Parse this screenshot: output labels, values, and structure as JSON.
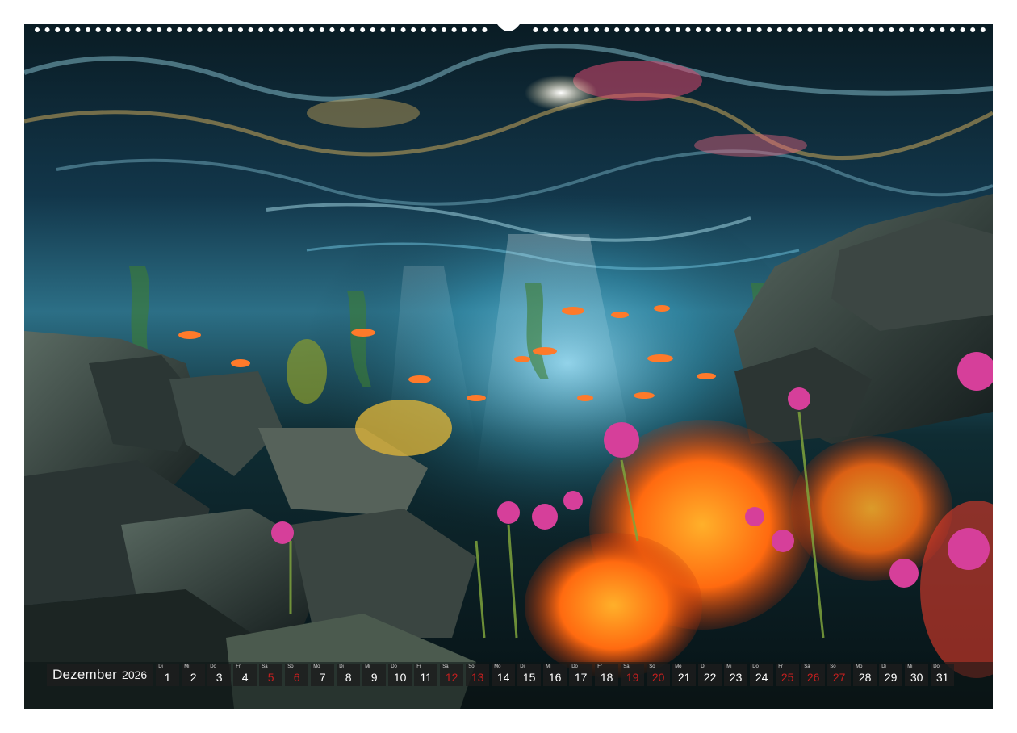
{
  "calendar": {
    "month": "Dezember",
    "year": "2026",
    "days": [
      {
        "wd": "Di",
        "n": "1",
        "red": false
      },
      {
        "wd": "Mi",
        "n": "2",
        "red": false
      },
      {
        "wd": "Do",
        "n": "3",
        "red": false
      },
      {
        "wd": "Fr",
        "n": "4",
        "red": false
      },
      {
        "wd": "Sa",
        "n": "5",
        "red": true
      },
      {
        "wd": "So",
        "n": "6",
        "red": true
      },
      {
        "wd": "Mo",
        "n": "7",
        "red": false
      },
      {
        "wd": "Di",
        "n": "8",
        "red": false
      },
      {
        "wd": "Mi",
        "n": "9",
        "red": false
      },
      {
        "wd": "Do",
        "n": "10",
        "red": false
      },
      {
        "wd": "Fr",
        "n": "11",
        "red": false
      },
      {
        "wd": "Sa",
        "n": "12",
        "red": true
      },
      {
        "wd": "So",
        "n": "13",
        "red": true
      },
      {
        "wd": "Mo",
        "n": "14",
        "red": false
      },
      {
        "wd": "Di",
        "n": "15",
        "red": false
      },
      {
        "wd": "Mi",
        "n": "16",
        "red": false
      },
      {
        "wd": "Do",
        "n": "17",
        "red": false
      },
      {
        "wd": "Fr",
        "n": "18",
        "red": false
      },
      {
        "wd": "Sa",
        "n": "19",
        "red": true
      },
      {
        "wd": "So",
        "n": "20",
        "red": true
      },
      {
        "wd": "Mo",
        "n": "21",
        "red": false
      },
      {
        "wd": "Di",
        "n": "22",
        "red": false
      },
      {
        "wd": "Mi",
        "n": "23",
        "red": false
      },
      {
        "wd": "Do",
        "n": "24",
        "red": false
      },
      {
        "wd": "Fr",
        "n": "25",
        "red": true
      },
      {
        "wd": "Sa",
        "n": "26",
        "red": true
      },
      {
        "wd": "So",
        "n": "27",
        "red": true
      },
      {
        "wd": "Mo",
        "n": "28",
        "red": false
      },
      {
        "wd": "Di",
        "n": "29",
        "red": false
      },
      {
        "wd": "Mi",
        "n": "30",
        "red": false
      },
      {
        "wd": "Do",
        "n": "31",
        "red": false
      }
    ]
  },
  "colors": {
    "weekday_number": "#ffffff",
    "holiday_number": "#c41f1f",
    "cell_background": "#1e1e1e"
  }
}
